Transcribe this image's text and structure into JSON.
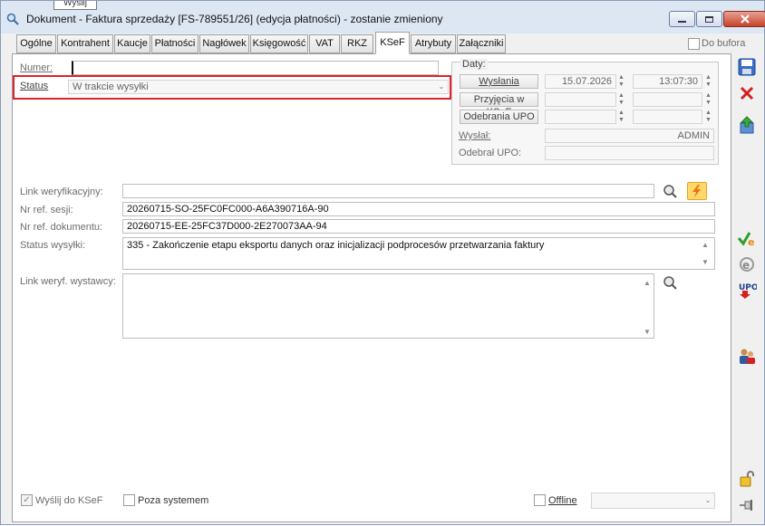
{
  "window": {
    "title": "Dokument - Faktura sprzedaży [FS-789551/26] (edycja płatności) - zostanie zmieniony",
    "tooltip": "Wyślij"
  },
  "tabs": [
    {
      "label": "Ogólne"
    },
    {
      "label": "Kontrahent"
    },
    {
      "label": "Kaucje"
    },
    {
      "label": "Płatności"
    },
    {
      "label": "Nagłówek"
    },
    {
      "label": "Księgowość"
    },
    {
      "label": "VAT"
    },
    {
      "label": "RKZ"
    },
    {
      "label": "KSeF",
      "active": true
    },
    {
      "label": "Atrybuty"
    },
    {
      "label": "Załączniki"
    }
  ],
  "do_bufora": {
    "label": "Do bufora",
    "checked": false
  },
  "form": {
    "numer_label": "Numer:",
    "numer_value": "",
    "status_label": "Status",
    "status_value": "W trakcie wysyłki",
    "daty_label": "Daty:",
    "wyslania_label": "Wysłania",
    "wyslania_date": "15.07.2026",
    "wyslania_time": "13:07:30",
    "przyjecia_label": "Przyjęcia w KSeF",
    "przyjecia_date": "",
    "przyjecia_time": "",
    "odebrania_label": "Odebrania UPO",
    "odebrania_date": "",
    "odebrania_time": "",
    "wyslal_label": "Wysłał:",
    "wyslal_value": "ADMIN",
    "odebral_label": "Odebrał UPO:",
    "odebral_value": "",
    "link_label": "Link weryfikacyjny:",
    "link_value": "",
    "sesji_label": "Nr ref. sesji:",
    "sesji_value": "20260715-SO-25FC0FC000-A6A390716A-90",
    "dokumentu_label": "Nr ref. dokumentu:",
    "dokumentu_value": "20260715-EE-25FC37D000-2E270073AA-94",
    "status_wysylki_label": "Status wysyłki:",
    "status_wysylki_value": "335 - Zakończenie etapu eksportu danych oraz inicjalizacji podprocesów przetwarzania faktury",
    "link_wystawcy_label": "Link weryf. wystawcy:",
    "link_wystawcy_value": ""
  },
  "bottom": {
    "wyslij_label": "Wyślij do KSeF",
    "wyslij_checked": true,
    "poza_label": "Poza systemem",
    "poza_checked": false,
    "offline_label": "Offline",
    "offline_checked": false,
    "offline_value": ""
  },
  "toolbar": {
    "upo_label": "UPO"
  },
  "colors": {
    "highlight": "#e0202a",
    "titlebar": "#dde7f4"
  }
}
